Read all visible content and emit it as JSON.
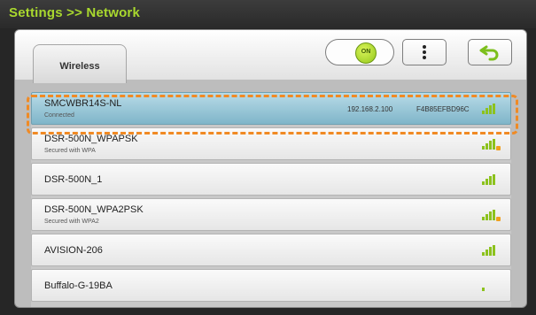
{
  "header": {
    "title": "Settings >> Network"
  },
  "tabs": [
    {
      "label": "Wireless"
    }
  ],
  "toolbar": {
    "toggle_label": "ON",
    "more_icon": "vertical-ellipsis-icon",
    "back_icon": "back-arrow-icon"
  },
  "colors": {
    "accent": "#a9d82e",
    "signal": "#8cc21d",
    "selected_row": "#9cc9d8",
    "highlight_border": "#f08a24"
  },
  "networks": [
    {
      "ssid": "SMCWBR14S-NL",
      "status": "Connected",
      "ip": "192.168.2.100",
      "mac": "F4B85EFBD96C",
      "signal_bars": 4,
      "secured": false,
      "selected": true
    },
    {
      "ssid": "DSR-500N_WPAPSK",
      "status": "Secured with WPA",
      "signal_bars": 4,
      "secured": true
    },
    {
      "ssid": "DSR-500N_1",
      "status": "",
      "signal_bars": 4,
      "secured": false
    },
    {
      "ssid": "DSR-500N_WPA2PSK",
      "status": "Secured with WPA2",
      "signal_bars": 4,
      "secured": true
    },
    {
      "ssid": "AVISION-206",
      "status": "",
      "signal_bars": 4,
      "secured": false
    },
    {
      "ssid": "Buffalo-G-19BA",
      "status": "",
      "signal_bars": 1,
      "secured": false
    }
  ]
}
